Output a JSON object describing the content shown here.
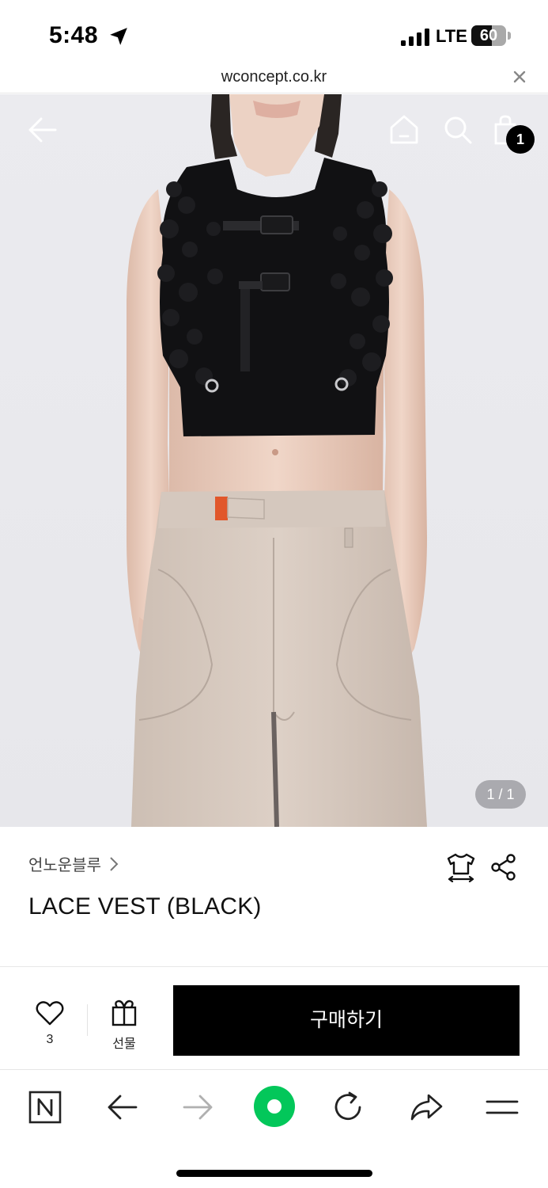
{
  "status_bar": {
    "time": "5:48",
    "network": "LTE",
    "battery": "60",
    "battery_level": 0.6
  },
  "browser": {
    "url": "wconcept.co.kr"
  },
  "header": {
    "cart_count": "1",
    "icons": [
      "back-arrow-icon",
      "home-icon",
      "search-icon",
      "shopping-bag-icon"
    ]
  },
  "gallery": {
    "counter": "1 / 1"
  },
  "product": {
    "brand": "언노운블루",
    "name": "LACE VEST (BLACK)"
  },
  "actions": {
    "like_count": "3",
    "gift_label": "선물",
    "buy_label": "구매하기"
  },
  "colors": {
    "accent": "#03c75a",
    "buy_button": "#000000",
    "badge": "#000000"
  },
  "toolbar": {
    "icons": [
      "naver-n-icon",
      "back-arrow-icon",
      "forward-arrow-icon",
      "green-dot-icon",
      "refresh-icon",
      "share-arrow-icon",
      "menu-icon"
    ]
  }
}
